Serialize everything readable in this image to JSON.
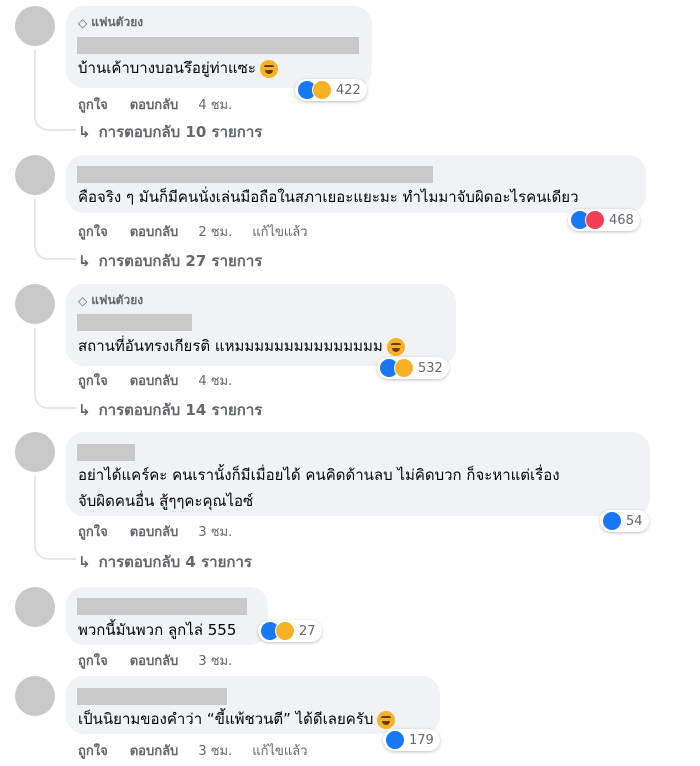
{
  "actions": {
    "like": "ถูกใจ",
    "reply": "ตอบกลับ",
    "edited": "แก้ไขแล้ว"
  },
  "badge_fan": "แฟนตัวยง",
  "comments": [
    {
      "text": "บ้านเค้าบางบอนรึอยู่ท่าแซะ",
      "time": "4 ชม.",
      "reactions": [
        "like-icon",
        "haha-icon"
      ],
      "count": "422",
      "replies": "การตอบกลับ 10 รายการ",
      "fan": true
    },
    {
      "text": "คือจริง ๆ มันก็มีคนนั่งเล่นมือถือในสภาเยอะแยะมะ ทำไมมาจับผิดอะไรคนเดียว",
      "time": "2 ชม.",
      "reactions": [
        "like-icon",
        "love-icon"
      ],
      "count": "468",
      "replies": "การตอบกลับ 27 รายการ",
      "fan": false,
      "edited": true
    },
    {
      "text": "สถานที่อันทรงเกียรติ แหมมมมมมมมมมมมมมม",
      "time": "4 ชม.",
      "reactions": [
        "like-icon",
        "haha-icon"
      ],
      "count": "532",
      "replies": "การตอบกลับ 14 รายการ",
      "fan": true
    },
    {
      "text1": "อย่าได้แคร์คะ คนเรานั้งก็มีเมื่อยได้ คนคิดด้านลบ ไม่คิดบวก ก็จะหาแต่เรื่อง",
      "text2": "จับผิดคนอื่น สู้ๆๆคะคุณไอซ์",
      "time": "3 ชม.",
      "reactions": [
        "like-icon"
      ],
      "count": "54",
      "replies": "การตอบกลับ 4 รายการ",
      "fan": false
    },
    {
      "text": "พวกนี้มันพวก ลูกไล่ 555",
      "time": "3 ชม.",
      "reactions": [
        "like-icon",
        "haha-icon"
      ],
      "count": "27",
      "fan": false
    },
    {
      "text": "เป็นนิยามของคำว่า “ขี้แพ้ชวนตี” ได้ดีเลยครับ",
      "time": "3 ชม.",
      "reactions": [
        "like-icon"
      ],
      "count": "179",
      "fan": false,
      "edited": true
    }
  ]
}
